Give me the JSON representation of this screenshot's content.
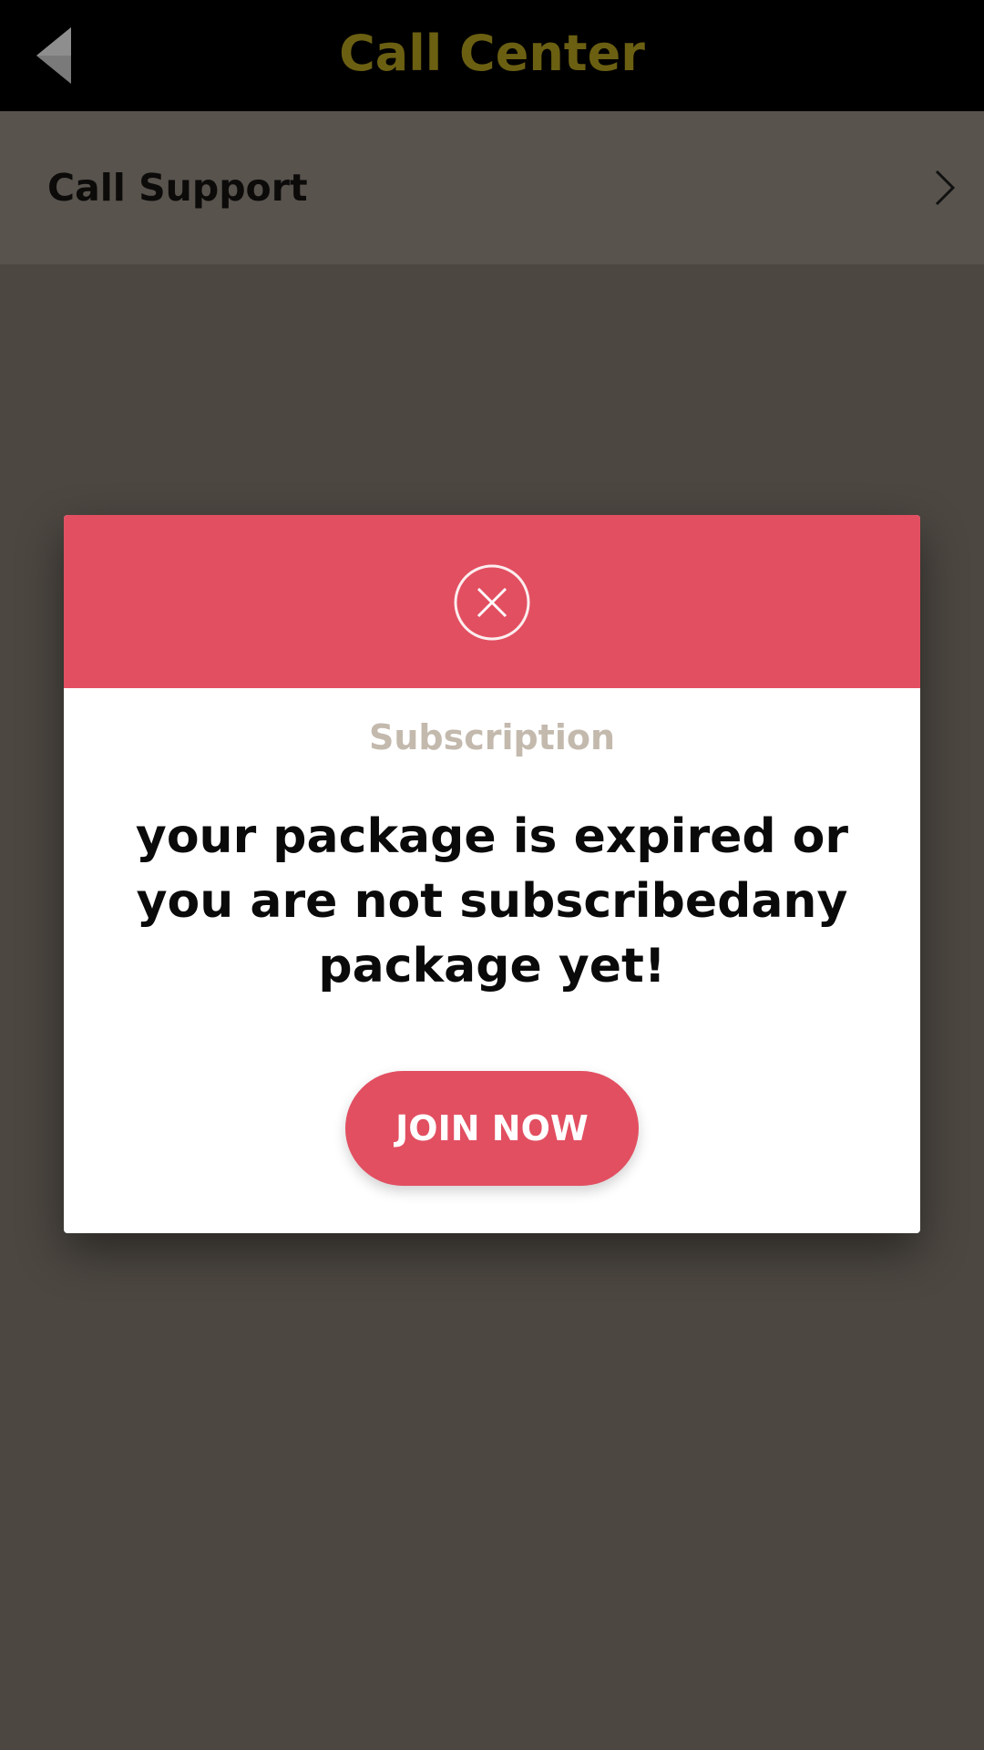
{
  "header": {
    "title": "Call Center",
    "back_icon": "back-arrow-icon"
  },
  "list": {
    "items": [
      {
        "label": "Call Support",
        "icon": "chevron-right-icon"
      }
    ]
  },
  "modal": {
    "status_icon": "close-circle-icon",
    "title": "Subscription",
    "message": "your package is expired or you are not subscribedany package yet!",
    "button_label": "JOIN NOW"
  },
  "colors": {
    "header_bg": "#000000",
    "header_title": "#6b5f12",
    "page_bg": "#4c4741",
    "row_bg": "#58534d",
    "accent": "#e24f61",
    "modal_title": "#c3b9ad"
  }
}
